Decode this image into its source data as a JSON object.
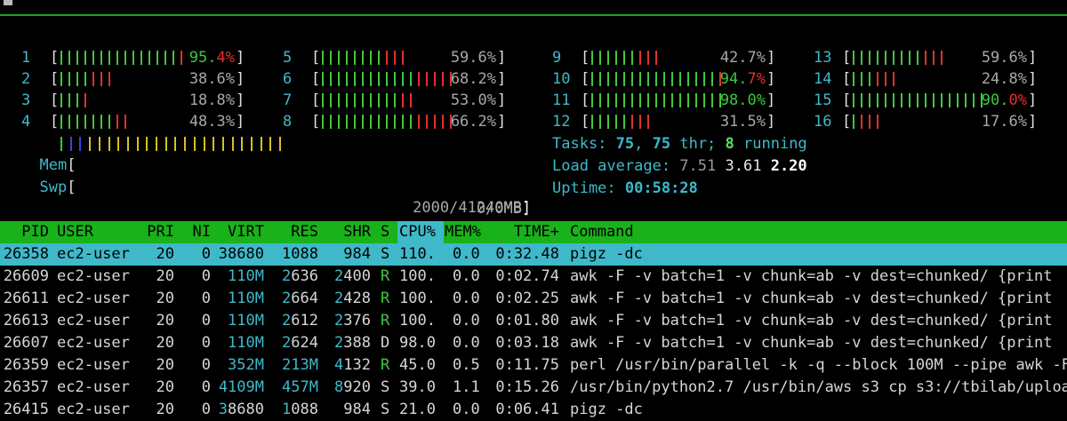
{
  "cpus": [
    {
      "id": "1",
      "pct_main": "95.",
      "pct_tail": "4%",
      "fill": 0.954,
      "pct_color": "red",
      "tick_colors": "gggggggggggggggr"
    },
    {
      "id": "2",
      "pct_main": "38.6%",
      "pct_tail": "",
      "fill": 0.386,
      "pct_color": "gray",
      "tick_colors": "ggggrrr"
    },
    {
      "id": "3",
      "pct_main": "18.8%",
      "pct_tail": "",
      "fill": 0.188,
      "pct_color": "gray",
      "tick_colors": "gggr"
    },
    {
      "id": "4",
      "pct_main": "48.3%",
      "pct_tail": "",
      "fill": 0.483,
      "pct_color": "gray",
      "tick_colors": "gggggggrr"
    },
    {
      "id": "5",
      "pct_main": "59.6%",
      "pct_tail": "",
      "fill": 0.596,
      "pct_color": "gray",
      "tick_colors": "ggggggggrrr"
    },
    {
      "id": "6",
      "pct_main": "68.2%",
      "pct_tail": "",
      "fill": 0.682,
      "pct_color": "gray",
      "tick_colors": "ggggggggggggrrrrr"
    },
    {
      "id": "7",
      "pct_main": "53.0%",
      "pct_tail": "",
      "fill": 0.53,
      "pct_color": "gray",
      "tick_colors": "ggggggggggrr"
    },
    {
      "id": "8",
      "pct_main": "66.2%",
      "pct_tail": "",
      "fill": 0.662,
      "pct_color": "gray",
      "tick_colors": "ggggggggggggrrrrr"
    },
    {
      "id": "9",
      "pct_main": "42.7%",
      "pct_tail": "",
      "fill": 0.427,
      "pct_color": "gray",
      "tick_colors": "ggggggrrr"
    },
    {
      "id": "10",
      "pct_main": "94.",
      "pct_tail": "7%",
      "fill": 0.947,
      "pct_color": "red",
      "tick_colors": "ggggggggggggggggr"
    },
    {
      "id": "11",
      "pct_main": "98.0%",
      "pct_tail": "",
      "fill": 0.98,
      "pct_color": "green",
      "tick_colors": "gggggggggggggggggg"
    },
    {
      "id": "12",
      "pct_main": "31.5%",
      "pct_tail": "",
      "fill": 0.315,
      "pct_color": "gray",
      "tick_colors": "gggggrrr"
    },
    {
      "id": "13",
      "pct_main": "59.6%",
      "pct_tail": "",
      "fill": 0.596,
      "pct_color": "gray",
      "tick_colors": "gggggggggrrr"
    },
    {
      "id": "14",
      "pct_main": "24.8%",
      "pct_tail": "",
      "fill": 0.248,
      "pct_color": "gray",
      "tick_colors": "gggrrr"
    },
    {
      "id": "15",
      "pct_main": "90.",
      "pct_tail": "0%",
      "fill": 0.9,
      "pct_color": "red",
      "tick_colors": "ggggggggggggggggg"
    },
    {
      "id": "16",
      "pct_main": "17.6%",
      "pct_tail": "",
      "fill": 0.176,
      "pct_color": "gray",
      "tick_colors": "grrr"
    }
  ],
  "mem": {
    "label": "Mem",
    "value": "2000/41240MB",
    "tick_colors": "gbbyyyyyyyyyyyyyyyyyyyyy"
  },
  "swp": {
    "label": "Swp",
    "value": "0/0MB"
  },
  "tasks": {
    "label": "Tasks: ",
    "count": "75",
    "sep": ", ",
    "threads": "75",
    "thr_label": " thr; ",
    "running": "8",
    "running_label": " running"
  },
  "load": {
    "label": "Load average: ",
    "l1": "7.51",
    "l5": "3.61",
    "l15": "2.20"
  },
  "uptime": {
    "label": "Uptime: ",
    "value": "00:58:28"
  },
  "columns": [
    "PID",
    "USER",
    "PRI",
    "NI",
    "VIRT",
    "RES",
    "SHR",
    "S",
    "CPU%",
    "MEM%",
    "TIME+",
    "Command"
  ],
  "processes": [
    {
      "pid": "26358",
      "user": "ec2-user",
      "pri": "20",
      "ni": "0",
      "virt": "38680",
      "res": "1088",
      "shr": "984",
      "s": "S",
      "cpu": "110.",
      "mem": "0.0",
      "time": "0:32.48",
      "cmd": "pigz -dc",
      "selected": true
    },
    {
      "pid": "26609",
      "user": "ec2-user",
      "pri": "20",
      "ni": "0",
      "virt": "110M",
      "res": "2636",
      "shr": "2400",
      "s": "R",
      "cpu": "100.",
      "mem": "0.0",
      "time": "0:02.74",
      "cmd": "awk -F -v batch=1 -v chunk=ab -v dest=chunked/ {print"
    },
    {
      "pid": "26611",
      "user": "ec2-user",
      "pri": "20",
      "ni": "0",
      "virt": "110M",
      "res": "2664",
      "shr": "2428",
      "s": "R",
      "cpu": "100.",
      "mem": "0.0",
      "time": "0:02.25",
      "cmd": "awk -F -v batch=1 -v chunk=ab -v dest=chunked/ {print"
    },
    {
      "pid": "26613",
      "user": "ec2-user",
      "pri": "20",
      "ni": "0",
      "virt": "110M",
      "res": "2612",
      "shr": "2376",
      "s": "R",
      "cpu": "100.",
      "mem": "0.0",
      "time": "0:01.80",
      "cmd": "awk -F -v batch=1 -v chunk=ab -v dest=chunked/ {print"
    },
    {
      "pid": "26607",
      "user": "ec2-user",
      "pri": "20",
      "ni": "0",
      "virt": "110M",
      "res": "2624",
      "shr": "2388",
      "s": "D",
      "cpu": "98.0",
      "mem": "0.0",
      "time": "0:03.18",
      "cmd": "awk -F -v batch=1 -v chunk=ab -v dest=chunked/ {print"
    },
    {
      "pid": "26359",
      "user": "ec2-user",
      "pri": "20",
      "ni": "0",
      "virt": "352M",
      "res": "213M",
      "shr": "4132",
      "s": "R",
      "cpu": "45.0",
      "mem": "0.5",
      "time": "0:11.75",
      "cmd": "perl /usr/bin/parallel -k -q --block 100M --pipe awk -F"
    },
    {
      "pid": "26357",
      "user": "ec2-user",
      "pri": "20",
      "ni": "0",
      "virt": "4109M",
      "res": "457M",
      "shr": "8920",
      "s": "S",
      "cpu": "39.0",
      "mem": "1.1",
      "time": "0:15.26",
      "cmd": "/usr/bin/python2.7 /usr/bin/aws s3 cp s3://tbilab/uploa"
    },
    {
      "pid": "26415",
      "user": "ec2-user",
      "pri": "20",
      "ni": "0",
      "virt": "38680",
      "res": "1088",
      "shr": "984",
      "s": "S",
      "cpu": "21.0",
      "mem": "0.0",
      "time": "0:06.41",
      "cmd": "pigz -dc"
    }
  ],
  "colors": {
    "green": "#3cc83c",
    "red": "#e03030",
    "blue": "#4040e0",
    "yellow": "#d8c020",
    "cyan": "#3fb9c9",
    "header_bg": "#19b21a"
  }
}
